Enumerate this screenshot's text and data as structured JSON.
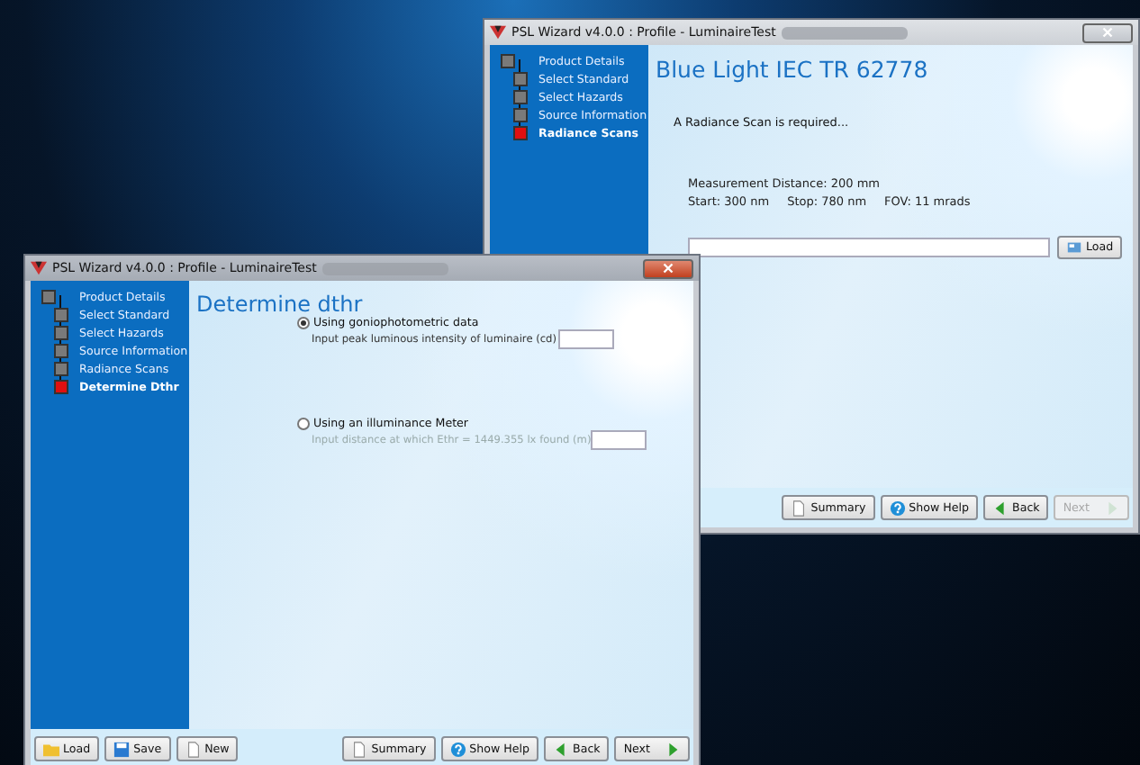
{
  "windows": [
    {
      "kind": "radiance",
      "active": false,
      "title": "PSL Wizard v4.0.0 : Profile - LuminaireTest",
      "steps": [
        {
          "label": "Product Details",
          "selected": false
        },
        {
          "label": "Select Standard",
          "selected": false
        },
        {
          "label": "Select Hazards",
          "selected": false
        },
        {
          "label": "Source Information",
          "selected": false
        },
        {
          "label": "Radiance Scans",
          "selected": true
        }
      ],
      "heading": "Blue Light IEC TR 62778",
      "message": "A Radiance Scan is required...",
      "distance": "Measurement Distance: 200 mm",
      "scan": [
        "Start: 300 nm",
        "Stop: 780 nm",
        "FOV: 11 mrads"
      ],
      "file_button": {
        "label": "Load"
      },
      "right_buttons": [
        {
          "label": "Summary",
          "kind": "page",
          "disabled": false
        },
        {
          "label": "Show Help",
          "kind": "help",
          "disabled": false
        },
        {
          "label": "Back",
          "kind": "back",
          "disabled": false
        },
        {
          "label": "Next",
          "kind": "next",
          "disabled": true
        }
      ]
    },
    {
      "kind": "dthr",
      "active": true,
      "title": "PSL Wizard v4.0.0 : Profile - LuminaireTest",
      "steps": [
        {
          "label": "Product Details",
          "selected": false
        },
        {
          "label": "Select Standard",
          "selected": false
        },
        {
          "label": "Select Hazards",
          "selected": false
        },
        {
          "label": "Source Information",
          "selected": false
        },
        {
          "label": "Radiance Scans",
          "selected": false
        },
        {
          "label": "Determine Dthr",
          "selected": true
        }
      ],
      "heading": "Determine dthr",
      "options": [
        {
          "label": "Using goniophotometric data",
          "selected": true,
          "prompt": "Input peak luminous intensity of luminaire (cd)"
        },
        {
          "label": "Using an illuminance Meter",
          "selected": false,
          "prompt": "Input distance at which Ethr = 1449.355 lx found (m)"
        }
      ],
      "left_buttons": [
        {
          "label": "Load",
          "kind": "folder",
          "disabled": false
        },
        {
          "label": "Save",
          "kind": "disk",
          "disabled": false
        },
        {
          "label": "New",
          "kind": "page",
          "disabled": false
        }
      ],
      "right_buttons": [
        {
          "label": "Summary",
          "kind": "page",
          "disabled": false
        },
        {
          "label": "Show Help",
          "kind": "help",
          "disabled": false
        },
        {
          "label": "Back",
          "kind": "back",
          "disabled": false
        },
        {
          "label": "Next",
          "kind": "next",
          "disabled": false
        }
      ]
    }
  ]
}
